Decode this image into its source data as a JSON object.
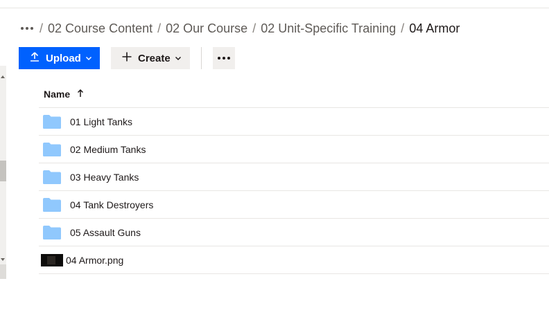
{
  "breadcrumb": {
    "items": [
      {
        "label": "02 Course Content"
      },
      {
        "label": "02 Our Course"
      },
      {
        "label": "02 Unit-Specific Training"
      },
      {
        "label": "04 Armor"
      }
    ],
    "separator": "/"
  },
  "toolbar": {
    "upload_label": "Upload",
    "create_label": "Create"
  },
  "list": {
    "column_name": "Name",
    "sort": "ascending",
    "rows": [
      {
        "name": "01 Light Tanks",
        "type": "folder"
      },
      {
        "name": "02 Medium Tanks",
        "type": "folder"
      },
      {
        "name": "03 Heavy Tanks",
        "type": "folder"
      },
      {
        "name": "04 Tank Destroyers",
        "type": "folder"
      },
      {
        "name": "05 Assault Guns",
        "type": "folder"
      },
      {
        "name": "04 Armor.png",
        "type": "image"
      }
    ]
  },
  "colors": {
    "accent": "#0061fe",
    "folder": "#90c8fd",
    "text": "#1e1919"
  }
}
